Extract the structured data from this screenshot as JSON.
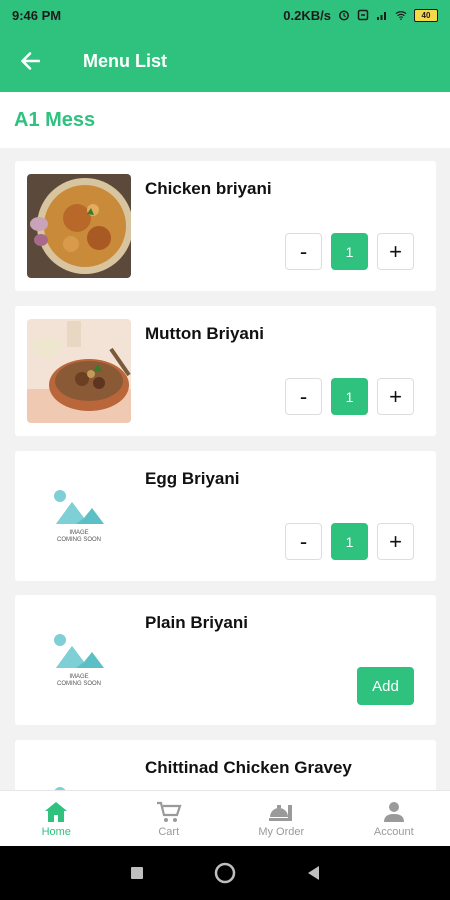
{
  "status_bar": {
    "time": "9:46 PM",
    "net_speed": "0.2KB/s",
    "battery": "40"
  },
  "app_bar": {
    "title": "Menu List",
    "back_icon": "arrow-left-icon"
  },
  "mess": {
    "name": "A1 Mess"
  },
  "menu_items": [
    {
      "name": "Chicken briyani",
      "qty": "1",
      "action": "stepper",
      "image": "chicken-biryani-photo"
    },
    {
      "name": "Mutton Briyani",
      "qty": "1",
      "action": "stepper",
      "image": "mutton-biryani-photo"
    },
    {
      "name": "Egg Briyani",
      "qty": "1",
      "action": "stepper",
      "image": "image-coming-soon"
    },
    {
      "name": "Plain Briyani",
      "action": "add",
      "add_label": "Add",
      "image": "image-coming-soon"
    },
    {
      "name": "Chittinad Chicken Gravey",
      "image": "image-coming-soon"
    }
  ],
  "stepper": {
    "minus": "-",
    "plus": "+"
  },
  "placeholder": {
    "line1": "IMAGE",
    "line2": "COMING SOON"
  },
  "bottom_nav": [
    {
      "label": "Home",
      "icon": "home-icon",
      "active": true
    },
    {
      "label": "Cart",
      "icon": "cart-icon",
      "active": false
    },
    {
      "label": "My Order",
      "icon": "order-icon",
      "active": false
    },
    {
      "label": "Account",
      "icon": "account-icon",
      "active": false
    }
  ],
  "colors": {
    "accent": "#2ec27e"
  }
}
